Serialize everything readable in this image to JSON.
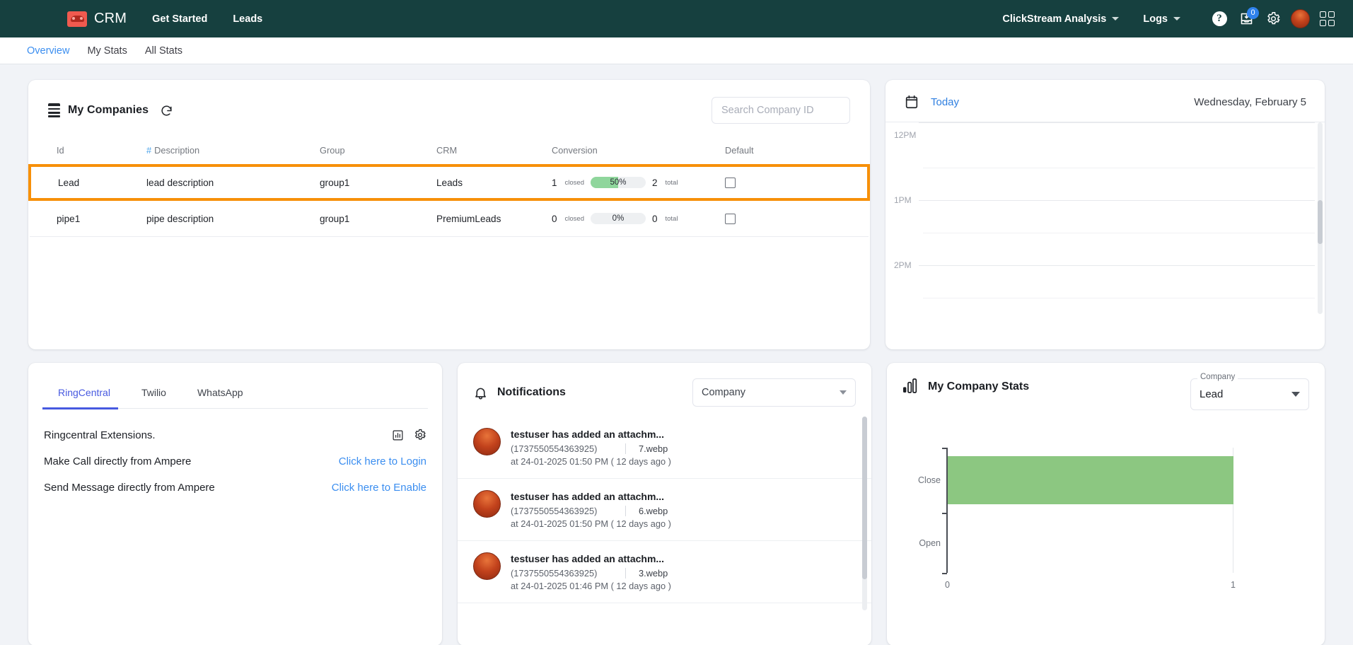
{
  "topnav": {
    "brand": "CRM",
    "links": [
      {
        "label": "Get Started"
      },
      {
        "label": "Leads"
      }
    ],
    "menus": [
      {
        "label": "ClickStream Analysis"
      },
      {
        "label": "Logs"
      }
    ],
    "help_glyph": "?",
    "inbox_badge": "0",
    "accent_color": "#16403f",
    "badge_color": "#2f82ec"
  },
  "subnav": {
    "tabs": [
      {
        "label": "Overview",
        "active": true
      },
      {
        "label": "My Stats",
        "active": false
      },
      {
        "label": "All Stats",
        "active": false
      }
    ],
    "active_color": "#3b8ef0"
  },
  "companies": {
    "title": "My Companies",
    "search_placeholder": "Search Company ID",
    "search_value": "",
    "columns": [
      "Id",
      "Description",
      "Group",
      "CRM",
      "Conversion",
      "Default"
    ],
    "description_prefix": "#",
    "rows": [
      {
        "id": "Lead",
        "description": "lead description",
        "group": "group1",
        "crm": "Leads",
        "closed": "1",
        "closed_label": "closed",
        "percent": "50%",
        "percent_value": 50,
        "total": "2",
        "total_label": "total",
        "default_checked": false,
        "highlighted": true
      },
      {
        "id": "pipe1",
        "description": "pipe description",
        "group": "group1",
        "crm": "PremiumLeads",
        "closed": "0",
        "closed_label": "closed",
        "percent": "0%",
        "percent_value": 0,
        "total": "0",
        "total_label": "total",
        "default_checked": false,
        "highlighted": false
      }
    ],
    "highlight_color": "#f79009",
    "bar_fill_color": "#8fd69c"
  },
  "calendar": {
    "today_label": "Today",
    "date_label": "Wednesday, February 5",
    "hours": [
      "12PM",
      "1PM",
      "2PM"
    ]
  },
  "channels": {
    "tabs": [
      {
        "label": "RingCentral",
        "active": true
      },
      {
        "label": "Twilio",
        "active": false
      },
      {
        "label": "WhatsApp",
        "active": false
      }
    ],
    "heading": "Ringcentral Extensions.",
    "rows": [
      {
        "label": "Make Call directly from Ampere",
        "link": "Click here to Login"
      },
      {
        "label": "Send Message directly from Ampere",
        "link": "Click here to Enable"
      }
    ],
    "active_color": "#4759e0"
  },
  "notifications": {
    "title": "Notifications",
    "filter_value": "Company",
    "items": [
      {
        "message": "testuser has added an attachm...",
        "id": "(1737550554363925)",
        "file": "7.webp",
        "time": "at 24-01-2025 01:50 PM ( 12 days ago )"
      },
      {
        "message": "testuser has added an attachm...",
        "id": "(1737550554363925)",
        "file": "6.webp",
        "time": "at 24-01-2025 01:50 PM ( 12 days ago )"
      },
      {
        "message": "testuser has added an attachm...",
        "id": "(1737550554363925)",
        "file": "3.webp",
        "time": "at 24-01-2025 01:46 PM ( 12 days ago )"
      }
    ]
  },
  "company_stats": {
    "title": "My Company Stats",
    "select_legend": "Company",
    "select_value": "Lead"
  },
  "chart_data": {
    "type": "bar",
    "orientation": "horizontal",
    "title": "My Company Stats",
    "categories": [
      "Close",
      "Open"
    ],
    "values": [
      1,
      0
    ],
    "xlabel": "",
    "ylabel": "",
    "xlim": [
      0,
      1
    ],
    "xticks": [
      "0",
      "1"
    ],
    "bar_color": "#8cc781",
    "grid": true,
    "legend": false
  }
}
